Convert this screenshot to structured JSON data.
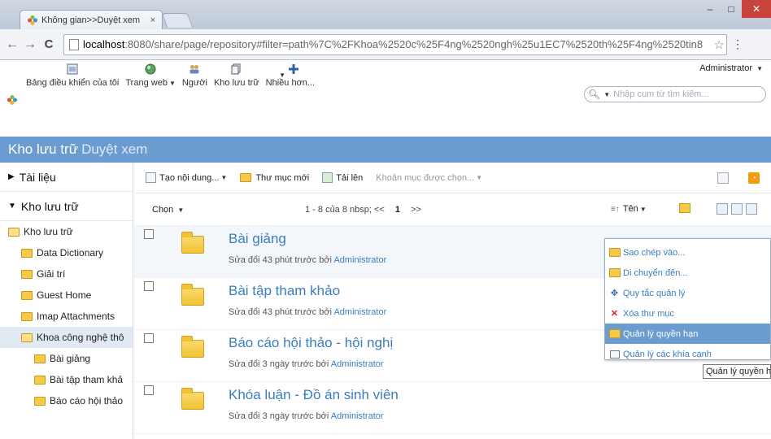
{
  "browser": {
    "tab_title": "Không gian>>Duyệt xem",
    "tab_close": "×",
    "url_host": "localhost",
    "url_path": ":8080/share/page/repository#filter=path%7C%2FKhoa%2520c%25F4ng%2520ngh%25u1EC7%2520th%25F4ng%2520tin8",
    "win_min": "–",
    "win_max": "□",
    "win_close": "✕"
  },
  "header": {
    "nav": [
      {
        "label": "Bảng điều khiển của tôi",
        "icon": "dashboard-icon"
      },
      {
        "label": "Trang web",
        "icon": "globe-icon"
      },
      {
        "label": "Người",
        "icon": "people-icon"
      },
      {
        "label": "Kho lưu trữ",
        "icon": "repository-icon"
      },
      {
        "label": "Nhiều hơn...",
        "icon": "plus-icon"
      }
    ],
    "user": "Administrator",
    "search_placeholder": "Nhập cụm từ tìm kiếm..."
  },
  "page_title": {
    "main": "Kho lưu trữ",
    "sub": "Duyệt xem"
  },
  "sidebar": {
    "sections": [
      "Tài liệu",
      "Kho lưu trữ"
    ],
    "tree": [
      {
        "label": "Kho lưu trữ",
        "level": 0,
        "open": true
      },
      {
        "label": "Data Dictionary",
        "level": 1
      },
      {
        "label": "Giải trí",
        "level": 1
      },
      {
        "label": "Guest Home",
        "level": 1
      },
      {
        "label": "Imap Attachments",
        "level": 1
      },
      {
        "label": "Khoa công nghệ thô",
        "level": 1,
        "open": true,
        "selected": true
      },
      {
        "label": "Bài giảng",
        "level": 2
      },
      {
        "label": "Bài tập tham khả",
        "level": 2
      },
      {
        "label": "Báo cáo hội thảo",
        "level": 2
      }
    ]
  },
  "actions": {
    "create": "Tạo nội dung...",
    "new_folder": "Thư mục mới",
    "upload": "Tải lên",
    "selected": "Khoản mục được chọn..."
  },
  "list": {
    "select": "Chọn",
    "paging": "1 - 8 của 8 nbsp; <<",
    "page_current": "1",
    "page_next": ">>",
    "sort": "Tên",
    "items": [
      {
        "name": "Bài giảng",
        "meta": "Sửa đổi 43 phút trước bởi",
        "user": "Administrator"
      },
      {
        "name": "Bài tập tham khảo",
        "meta": "Sửa đổi 43 phút trước bởi",
        "user": "Administrator"
      },
      {
        "name": "Báo cáo hội thảo - hội nghị",
        "meta": "Sửa đổi 3 ngày trước bởi",
        "user": "Administrator"
      },
      {
        "name": "Khóa luận - Đồ án sinh viên",
        "meta": "Sửa đổi 3 ngày trước bởi",
        "user": "Administrator"
      }
    ]
  },
  "context_menu": {
    "items": [
      {
        "label": "Sao chép vào...",
        "icon": "copy-icon"
      },
      {
        "label": "Di chuyển đến...",
        "icon": "move-icon"
      },
      {
        "label": "Quy tắc quản lý",
        "icon": "rules-icon"
      },
      {
        "label": "Xóa thư mục",
        "icon": "delete-folder-icon"
      },
      {
        "label": "Quản lý quyền hạn",
        "icon": "permissions-icon",
        "active": true
      },
      {
        "label": "Quản lý các khía cạnh",
        "icon": "aspects-icon"
      }
    ],
    "tooltip": "Quản lý quyền hạn"
  },
  "colors": {
    "accent": "#6a9cd0",
    "link": "#3a7ebd",
    "folder": "#f1c232"
  }
}
